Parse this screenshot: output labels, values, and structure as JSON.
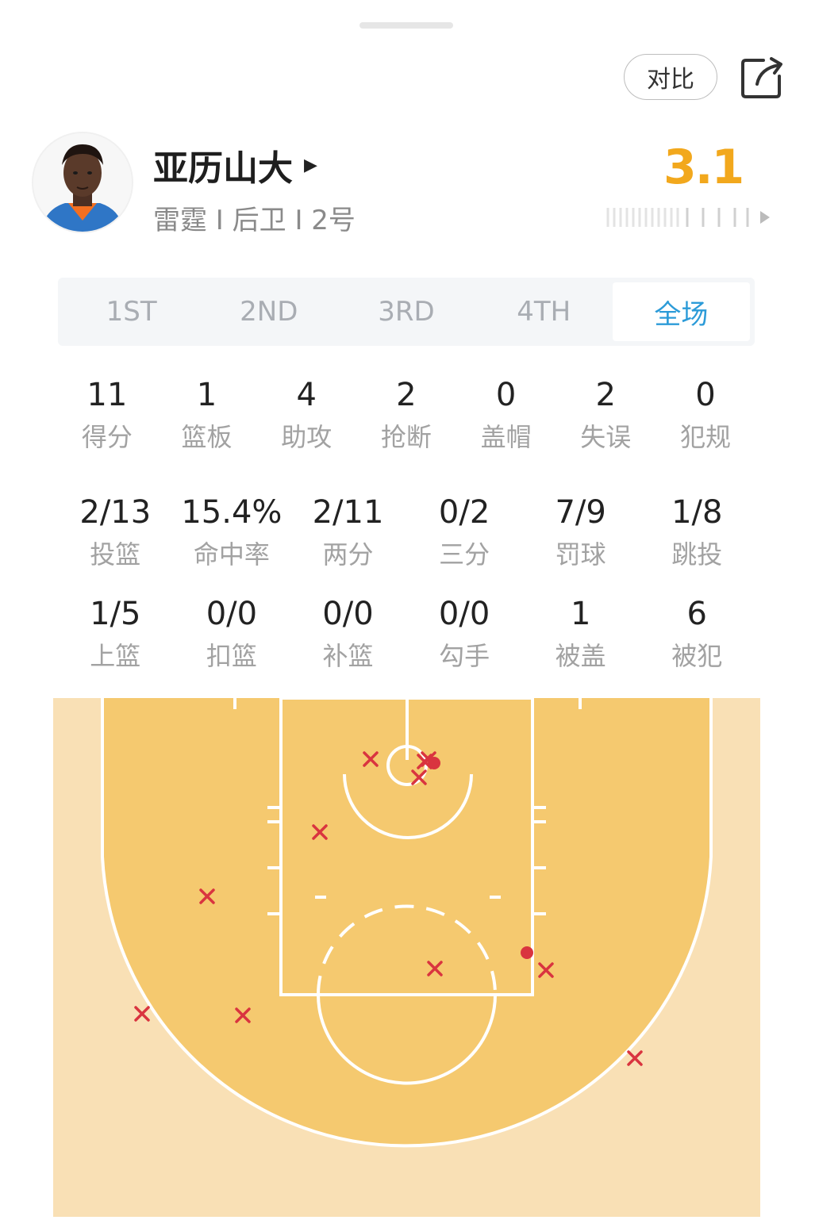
{
  "header": {
    "compare_label": "对比",
    "share_icon": "share-icon"
  },
  "player": {
    "name": "亚历山大",
    "meta": "雷霆 I 后卫 I 2号",
    "rating": "3.1",
    "rating_color": "#f2a81d"
  },
  "tabs": [
    {
      "label": "1ST",
      "active": false
    },
    {
      "label": "2ND",
      "active": false
    },
    {
      "label": "3RD",
      "active": false
    },
    {
      "label": "4TH",
      "active": false
    },
    {
      "label": "全场",
      "active": true
    }
  ],
  "stats_main": [
    {
      "value": "11",
      "label": "得分"
    },
    {
      "value": "1",
      "label": "篮板"
    },
    {
      "value": "4",
      "label": "助攻"
    },
    {
      "value": "2",
      "label": "抢断"
    },
    {
      "value": "0",
      "label": "盖帽"
    },
    {
      "value": "2",
      "label": "失误"
    },
    {
      "value": "0",
      "label": "犯规"
    }
  ],
  "stats_shooting": [
    {
      "value": "2/13",
      "label": "投篮"
    },
    {
      "value": "15.4%",
      "label": "命中率"
    },
    {
      "value": "2/11",
      "label": "两分"
    },
    {
      "value": "0/2",
      "label": "三分"
    },
    {
      "value": "7/9",
      "label": "罚球"
    },
    {
      "value": "1/8",
      "label": "跳投"
    }
  ],
  "stats_detail": [
    {
      "value": "1/5",
      "label": "上篮"
    },
    {
      "value": "0/0",
      "label": "扣篮"
    },
    {
      "value": "0/0",
      "label": "补篮"
    },
    {
      "value": "0/0",
      "label": "勾手"
    },
    {
      "value": "1",
      "label": "被盖"
    },
    {
      "value": "6",
      "label": "被犯"
    }
  ],
  "shot_chart": {
    "colors": {
      "court": "#f5c96f",
      "outside": "#f9e0b5",
      "miss": "#d9343f",
      "make": "#d9343f",
      "lines": "#ffffff"
    },
    "shots": [
      {
        "result": "miss"
      },
      {
        "result": "miss"
      },
      {
        "result": "miss"
      },
      {
        "result": "miss"
      },
      {
        "result": "miss"
      },
      {
        "result": "miss"
      },
      {
        "result": "make"
      },
      {
        "result": "miss"
      },
      {
        "result": "miss"
      },
      {
        "result": "miss"
      },
      {
        "result": "miss"
      },
      {
        "result": "miss"
      },
      {
        "result": "make"
      }
    ]
  }
}
